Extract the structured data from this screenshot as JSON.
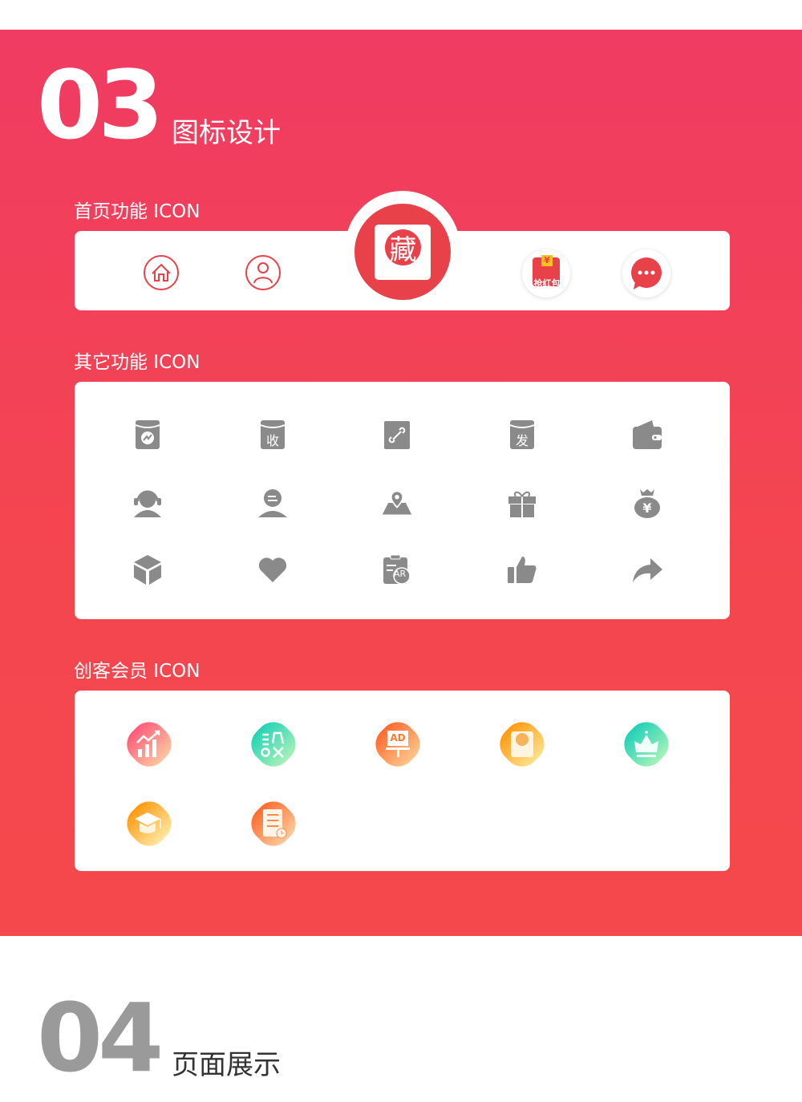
{
  "section03": {
    "number": "03",
    "title": "图标设计"
  },
  "home_icons": {
    "label": "首页功能 ICON",
    "center_char": "藏",
    "redpacket_text": "抢红包",
    "redpacket_yen": "¥",
    "items": [
      "home-icon",
      "user-icon",
      "collect-icon",
      "red-packet-icon",
      "chat-icon"
    ]
  },
  "other_icons": {
    "label": "其它功能 ICON",
    "ar_text": "AR",
    "receive_char": "收",
    "send_char": "发",
    "items": [
      "red-packet-chart-icon",
      "red-packet-receive-icon",
      "link-icon",
      "red-packet-send-icon",
      "wallet-icon",
      "customer-service-icon",
      "user-card-icon",
      "map-pin-icon",
      "gift-icon",
      "money-bag-icon",
      "cube-icon",
      "heart-icon",
      "ar-clipboard-icon",
      "thumbs-up-icon",
      "share-icon"
    ]
  },
  "member_icons": {
    "label": "创客会员 ICON",
    "ad_text": "AD",
    "items": [
      "growth-chart-icon",
      "settings-text-icon",
      "ad-board-icon",
      "collect-card-icon",
      "crown-icon",
      "graduation-cap-icon",
      "document-clock-icon"
    ]
  },
  "section04": {
    "number": "04",
    "title": "页面展示"
  },
  "colors": {
    "accent": "#e8414a",
    "icon_grey": "#8a8a8a",
    "bg_top": "#f03b62",
    "bg_bottom": "#f5484c"
  }
}
